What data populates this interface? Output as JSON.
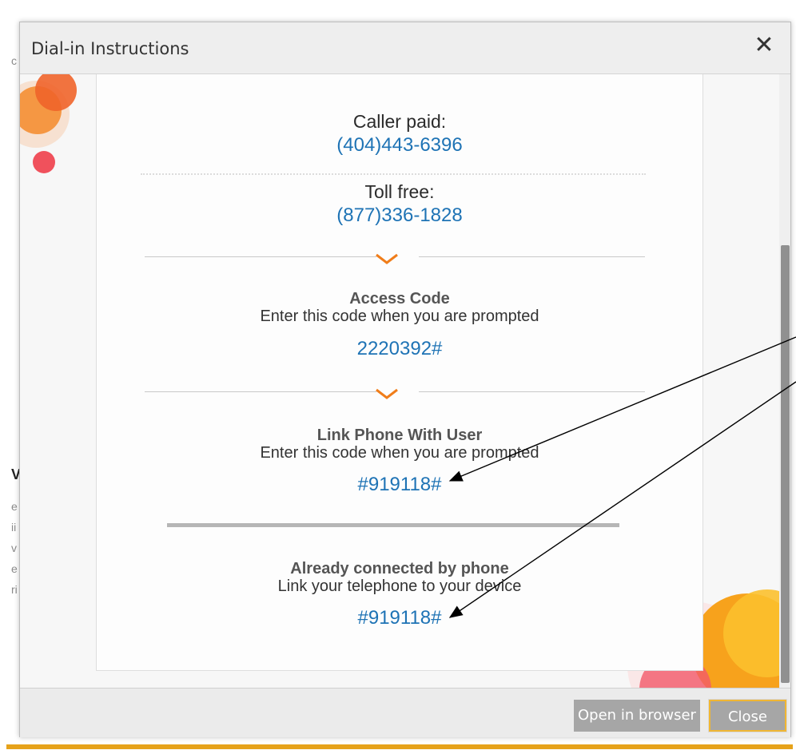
{
  "dialog": {
    "title": "Dial-in Instructions",
    "close_icon": "close-icon"
  },
  "dialin": {
    "caller_paid_label": "Caller paid:",
    "caller_paid_number": "(404)443-6396",
    "toll_free_label": "Toll free:",
    "toll_free_number": "(877)336-1828"
  },
  "access_code": {
    "heading": "Access Code",
    "instruction": "Enter this code when you are prompted",
    "code": "2220392#"
  },
  "link_phone": {
    "heading": "Link Phone With User",
    "instruction": "Enter this code when you are prompted",
    "code": "#919118#"
  },
  "already_connected": {
    "heading": "Already connected by phone",
    "instruction": "Link your telephone to your device",
    "code": "#919118#"
  },
  "footer": {
    "open_in_browser_label": "Open in browser",
    "close_label": "Close"
  },
  "colors": {
    "link": "#1e73b5",
    "accent": "#f07d1a",
    "focus_border": "#f0b633"
  }
}
